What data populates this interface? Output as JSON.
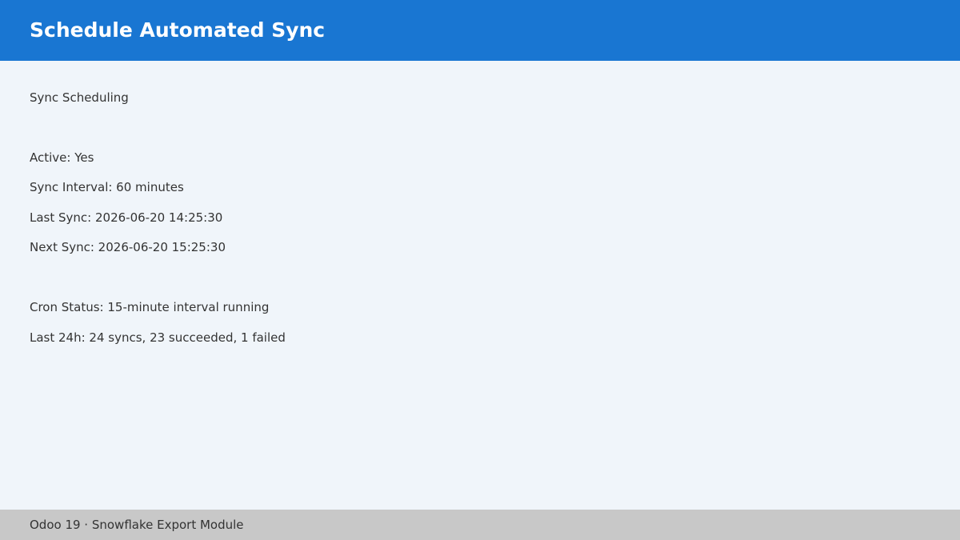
{
  "colors": {
    "header_bg": "#1976d2",
    "content_bg": "#f0f5fa",
    "footer_bg": "#c8c8c8",
    "text": "#333333"
  },
  "header": {
    "title": "Schedule Automated Sync"
  },
  "content": {
    "section_title": "Sync Scheduling",
    "active": "Active: Yes",
    "sync_interval": "Sync Interval: 60 minutes",
    "last_sync": "Last Sync: 2026-06-20 14:25:30",
    "next_sync": "Next Sync: 2026-06-20 15:25:30",
    "cron_status": "Cron Status: 15-minute interval running",
    "last_24h": "Last 24h: 24 syncs, 23 succeeded, 1 failed"
  },
  "footer": {
    "text": "Odoo 19 · Snowflake Export Module"
  }
}
